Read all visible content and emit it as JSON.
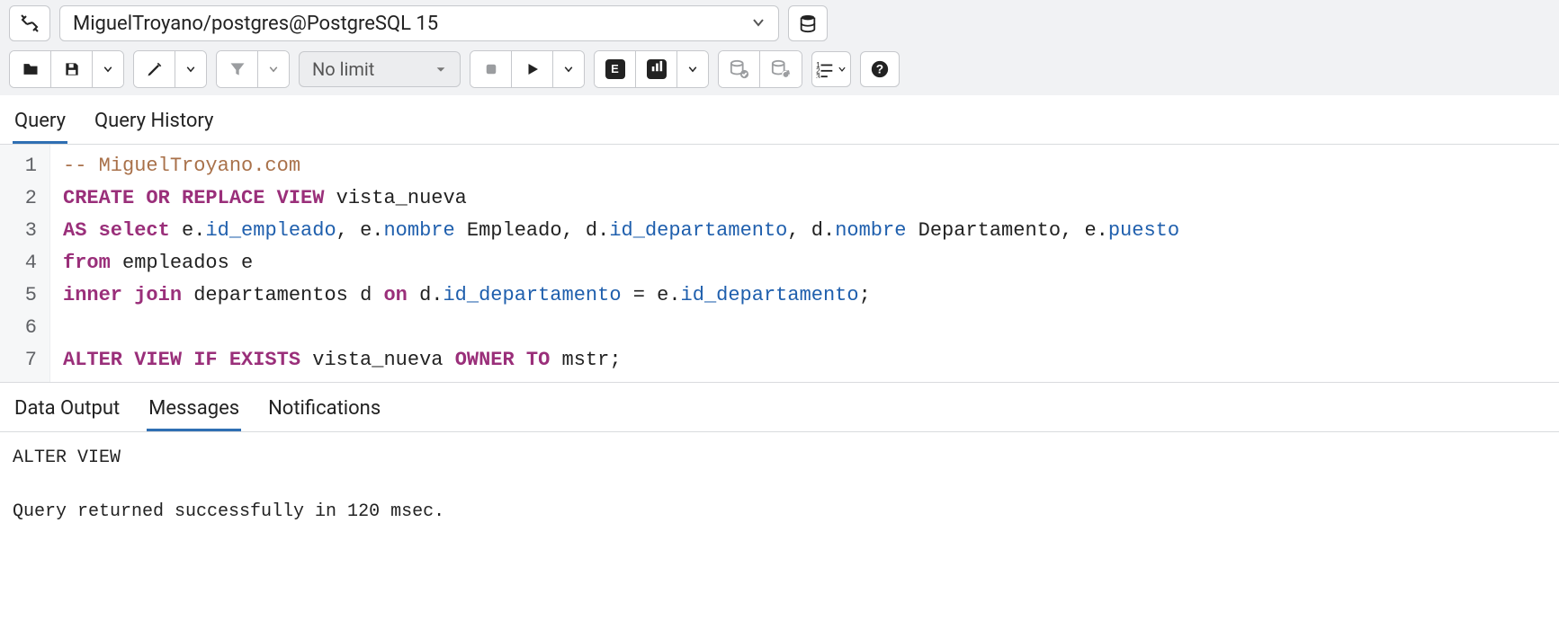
{
  "connection": {
    "label": "MiguelTroyano/postgres@PostgreSQL 15"
  },
  "toolbar": {
    "limit_label": "No limit"
  },
  "editor_tabs": {
    "query": "Query",
    "history": "Query History"
  },
  "code": {
    "lines": [
      {
        "n": 1,
        "tokens": [
          {
            "c": "tok-comment",
            "t": "-- MiguelTroyano.com"
          }
        ]
      },
      {
        "n": 2,
        "tokens": [
          {
            "c": "tok-kw",
            "t": "CREATE OR REPLACE VIEW"
          },
          {
            "c": "",
            "t": " vista_nueva"
          }
        ]
      },
      {
        "n": 3,
        "tokens": [
          {
            "c": "tok-kw",
            "t": "AS select"
          },
          {
            "c": "",
            "t": " e"
          },
          {
            "c": "tok-punct",
            "t": "."
          },
          {
            "c": "tok-ident",
            "t": "id_empleado"
          },
          {
            "c": "",
            "t": ", e"
          },
          {
            "c": "tok-punct",
            "t": "."
          },
          {
            "c": "tok-ident",
            "t": "nombre"
          },
          {
            "c": "",
            "t": " Empleado, d"
          },
          {
            "c": "tok-punct",
            "t": "."
          },
          {
            "c": "tok-ident",
            "t": "id_departamento"
          },
          {
            "c": "",
            "t": ", d"
          },
          {
            "c": "tok-punct",
            "t": "."
          },
          {
            "c": "tok-ident",
            "t": "nombre"
          },
          {
            "c": "",
            "t": " Departamento, e"
          },
          {
            "c": "tok-punct",
            "t": "."
          },
          {
            "c": "tok-ident",
            "t": "puesto"
          }
        ]
      },
      {
        "n": 4,
        "tokens": [
          {
            "c": "tok-kw",
            "t": "from"
          },
          {
            "c": "",
            "t": " empleados e"
          }
        ]
      },
      {
        "n": 5,
        "tokens": [
          {
            "c": "tok-kw",
            "t": "inner join"
          },
          {
            "c": "",
            "t": " departamentos d "
          },
          {
            "c": "tok-kw",
            "t": "on"
          },
          {
            "c": "",
            "t": " d"
          },
          {
            "c": "tok-punct",
            "t": "."
          },
          {
            "c": "tok-ident",
            "t": "id_departamento"
          },
          {
            "c": "",
            "t": " = e"
          },
          {
            "c": "tok-punct",
            "t": "."
          },
          {
            "c": "tok-ident",
            "t": "id_departamento"
          },
          {
            "c": "",
            "t": ";"
          }
        ]
      },
      {
        "n": 6,
        "tokens": []
      },
      {
        "n": 7,
        "tokens": [
          {
            "c": "tok-kw",
            "t": "ALTER VIEW IF EXISTS"
          },
          {
            "c": "",
            "t": " vista_nueva "
          },
          {
            "c": "tok-kw",
            "t": "OWNER TO"
          },
          {
            "c": "",
            "t": " mstr;"
          }
        ]
      }
    ]
  },
  "result_tabs": {
    "data_output": "Data Output",
    "messages": "Messages",
    "notifications": "Notifications"
  },
  "messages": {
    "line1": "ALTER VIEW",
    "line2": "Query returned successfully in 120 msec."
  }
}
